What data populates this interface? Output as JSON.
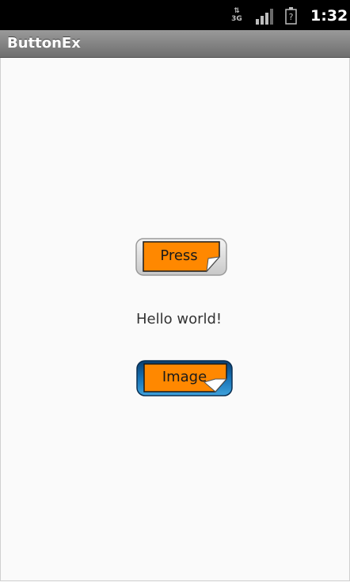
{
  "status_bar": {
    "network_label": "3G",
    "time": "1:32",
    "icons": [
      "data-arrows-icon",
      "signal-strength-icon",
      "battery-icon"
    ]
  },
  "title_bar": {
    "title": "ButtonEx"
  },
  "main": {
    "press_button": {
      "label": "Press"
    },
    "hello_text": "Hello world!",
    "image_button": {
      "label": "Image"
    }
  },
  "colors": {
    "button_orange": "#ff8800",
    "image_button_blue": "#1877b8",
    "title_bar_gray": "#808080",
    "background": "#fafafa"
  }
}
